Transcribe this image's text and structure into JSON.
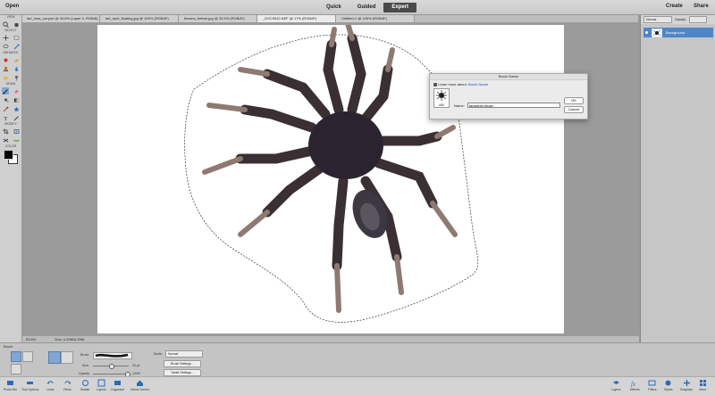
{
  "menubar": {
    "open_label": "Open",
    "create_label": "Create",
    "share_label": "Share"
  },
  "modes": {
    "quick": "Quick",
    "guided": "Guided",
    "expert": "Expert"
  },
  "tabs": [
    "tarl_russ_cur.psd @ 34.6% (Layer 0, RGB/8)",
    "tarl_spot_floating.jpg @ 100% (RGB/8*)",
    "flowers_before.jpg @ 33.4% (RGB/8*)",
    "_DSC9042.NEF @ 17% (RGB/8*)",
    "Untitled-1 @ 100% (RGB/8*)"
  ],
  "toolbox": {
    "view": "VIEW",
    "select": "SELECT",
    "enhance": "ENHANCE",
    "draw": "DRAW",
    "modify": "MODIFY",
    "color": "COLOR"
  },
  "layers": {
    "blend_mode": "Normal",
    "opacity_label": "Opacity:",
    "layer_name": "Background"
  },
  "status": {
    "zoom": "53.6%",
    "doc": "Doc: 4.20M/4.20M"
  },
  "dialog": {
    "title": "Brush Name",
    "learn_text": "Learn more about:",
    "learn_link": "Brush Name",
    "name_label": "Name:",
    "name_value": "tarantula brush",
    "size_label": "950",
    "ok": "OK",
    "cancel": "Cancel"
  },
  "options": {
    "tool_name": "Brush",
    "brush_label": "Brush:",
    "size_label": "Size:",
    "size_value": "30 px",
    "opacity_label": "Opacity:",
    "opacity_value": "100%",
    "mode_label": "Mode:",
    "mode_value": "Normal",
    "brush_settings": "Brush Settings...",
    "tablet_settings": "Tablet Settings..."
  },
  "bottom": {
    "photo_bin": "Photo Bin",
    "tool_options": "Tool Options",
    "undo": "Undo",
    "redo": "Redo",
    "rotate": "Rotate",
    "layout": "Layout",
    "organizer": "Organizer",
    "home": "Home Screen",
    "layers": "Layers",
    "effects": "Effects",
    "filters": "Filters",
    "styles": "Styles",
    "graphics": "Graphics",
    "more": "More"
  }
}
